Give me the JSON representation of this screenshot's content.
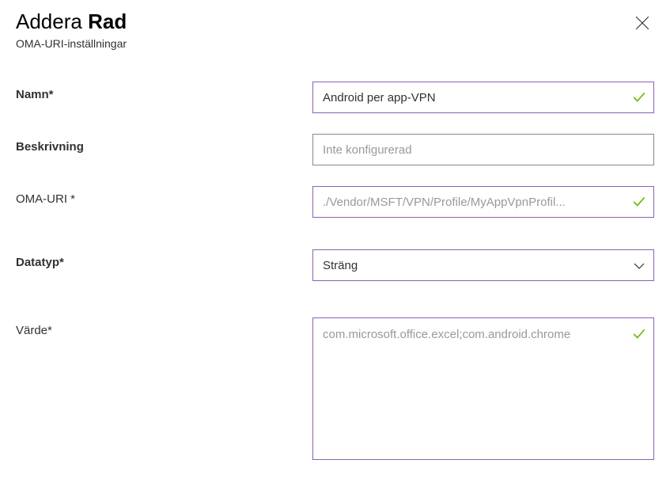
{
  "header": {
    "title_prefix": "Addera",
    "title_main": "Rad",
    "subtitle": "OMA-URI-inställningar"
  },
  "fields": {
    "name": {
      "label": "Namn*",
      "value": "Android per app-VPN"
    },
    "description": {
      "label": "Beskrivning",
      "placeholder": "Inte konfigurerad",
      "value": ""
    },
    "oma_uri": {
      "label": "OMA-URI *",
      "value": "./Vendor/MSFT/VPN/Profile/MyAppVpnProfil..."
    },
    "datatype": {
      "label": "Datatyp*",
      "value": "Sträng"
    },
    "value": {
      "label": "Värde*",
      "value": "com.microsoft.office.excel;com.android.chrome"
    }
  }
}
